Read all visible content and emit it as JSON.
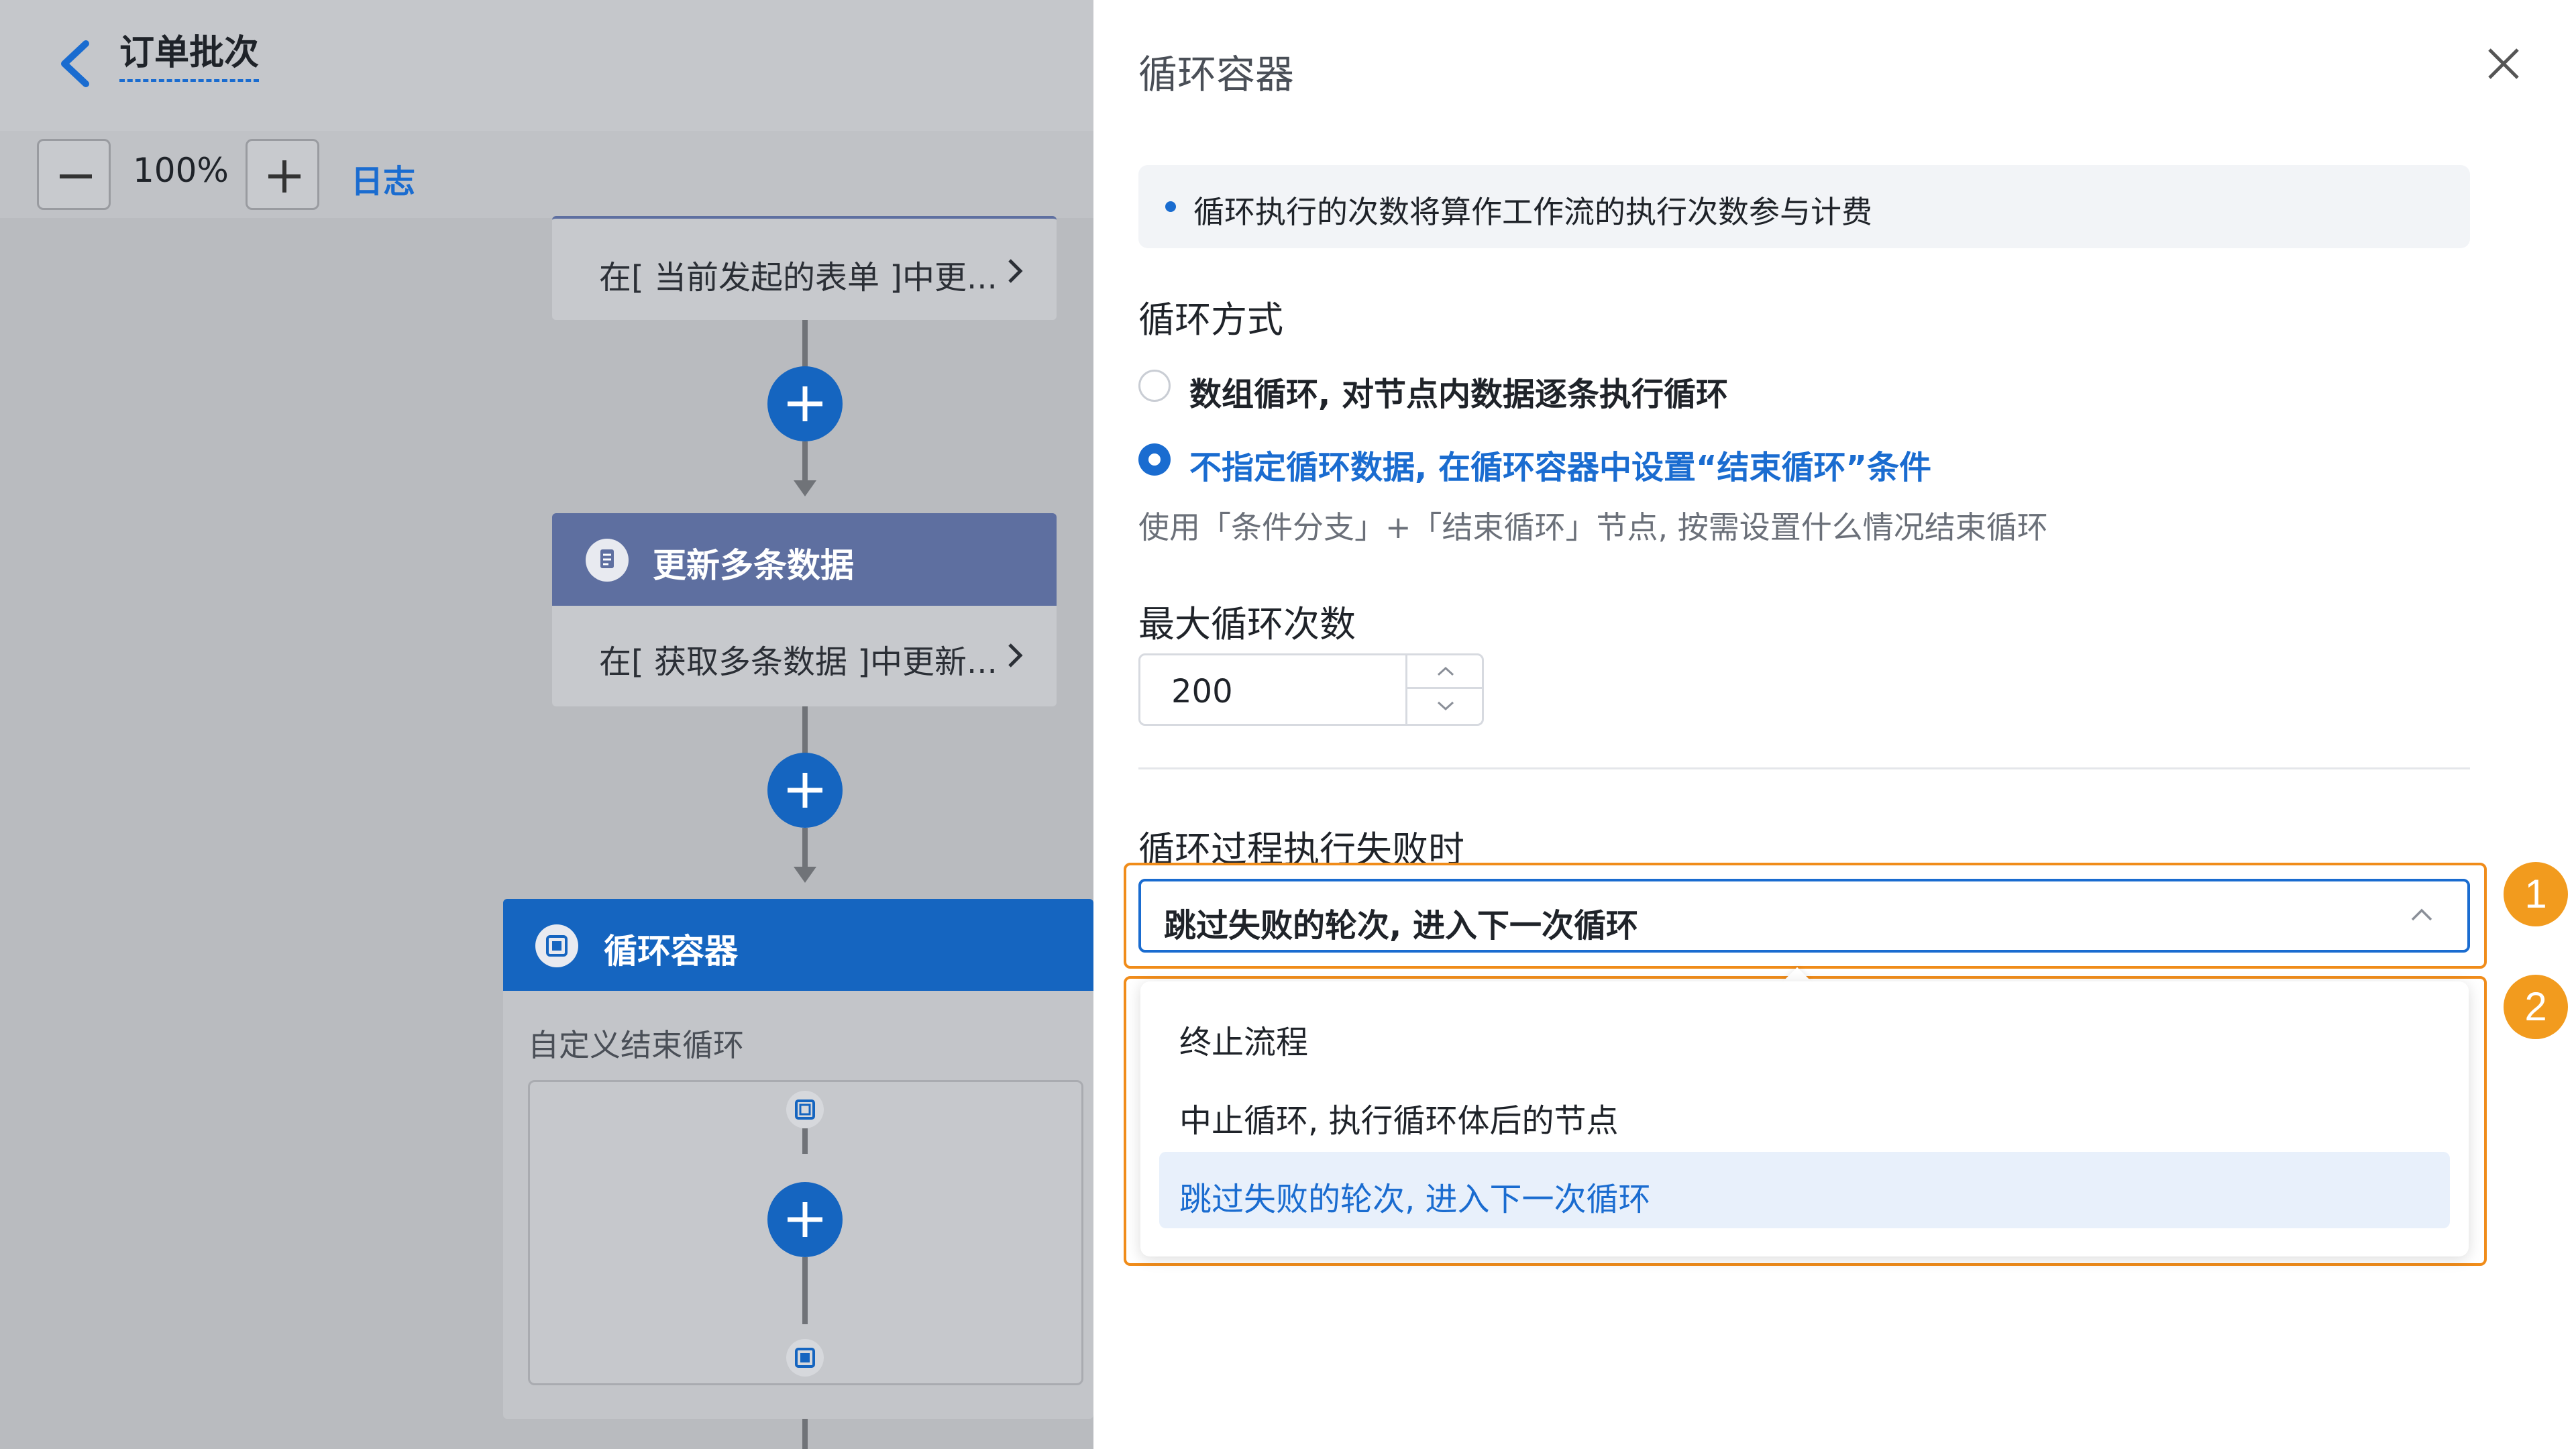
{
  "canvas": {
    "title": "订单批次",
    "zoom_level": "100%",
    "log_link": "日志",
    "nodes": {
      "update_form": {
        "body": "在[ 当前发起的表单 ]中更..."
      },
      "update_multi": {
        "title": "更新多条数据",
        "body": "在[ 获取多条数据 ]中更新..."
      },
      "loop_container": {
        "title": "循环容器",
        "subtitle": "自定义结束循环"
      }
    },
    "colors": {
      "node_header": "#5e6fa0",
      "loop_header": "#1565c0",
      "add_button": "#1565c0"
    }
  },
  "panel": {
    "title": "循环容器",
    "notice": "循环执行的次数将算作工作流的执行次数参与计费",
    "loop_mode": {
      "label": "循环方式",
      "options": [
        {
          "label": "数组循环, 对节点内数据逐条执行循环",
          "selected": false
        },
        {
          "label": "不指定循环数据, 在循环容器中设置“结束循环”条件",
          "selected": true
        }
      ],
      "hint": "使用「条件分支」+「结束循环」节点, 按需设置什么情况结束循环"
    },
    "max_loops": {
      "label": "最大循环次数",
      "value": "200"
    },
    "on_failure": {
      "label": "循环过程执行失败时",
      "selected_value": "跳过失败的轮次, 进入下一次循环",
      "options": [
        {
          "label": "终止流程",
          "selected": false
        },
        {
          "label": "中止循环, 执行循环体后的节点",
          "selected": false
        },
        {
          "label": "跳过失败的轮次, 进入下一次循环",
          "selected": true
        }
      ]
    },
    "callouts": [
      "1",
      "2"
    ],
    "colors": {
      "primary": "#1a6cd0",
      "callout": "#f29b1e"
    }
  }
}
